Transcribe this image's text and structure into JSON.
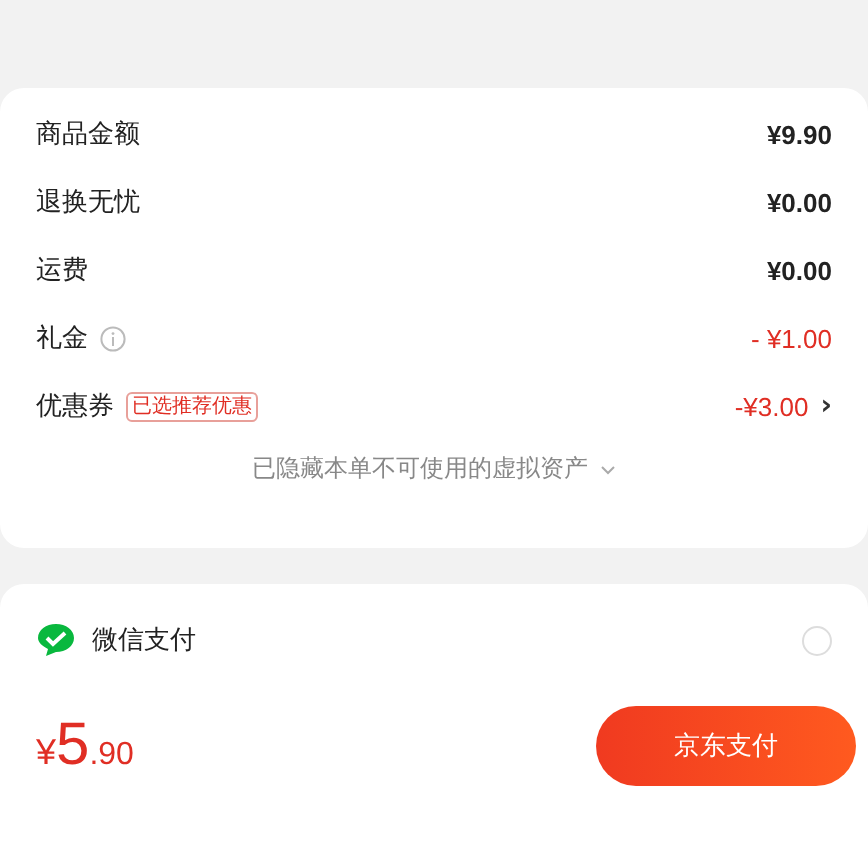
{
  "fees": [
    {
      "kind": "plain",
      "label": "商品金额",
      "value": "¥9.90"
    },
    {
      "kind": "plain",
      "label": "退换无忧",
      "value": "¥0.00"
    },
    {
      "kind": "plain",
      "label": "运费",
      "value": "¥0.00"
    },
    {
      "kind": "info",
      "label": "礼金",
      "value": "- ¥1.00"
    },
    {
      "kind": "coupon",
      "label": "优惠券",
      "tag": "已选推荐优惠",
      "value": "-¥3.00",
      "chevron": "›"
    }
  ],
  "hidden_note": "已隐藏本单不可使用的虚拟资产",
  "payment": {
    "method": "微信支付",
    "selected": false
  },
  "total": {
    "currency": "¥",
    "integer": "5",
    "decimal": ".90"
  },
  "pay_button": "京东支付"
}
